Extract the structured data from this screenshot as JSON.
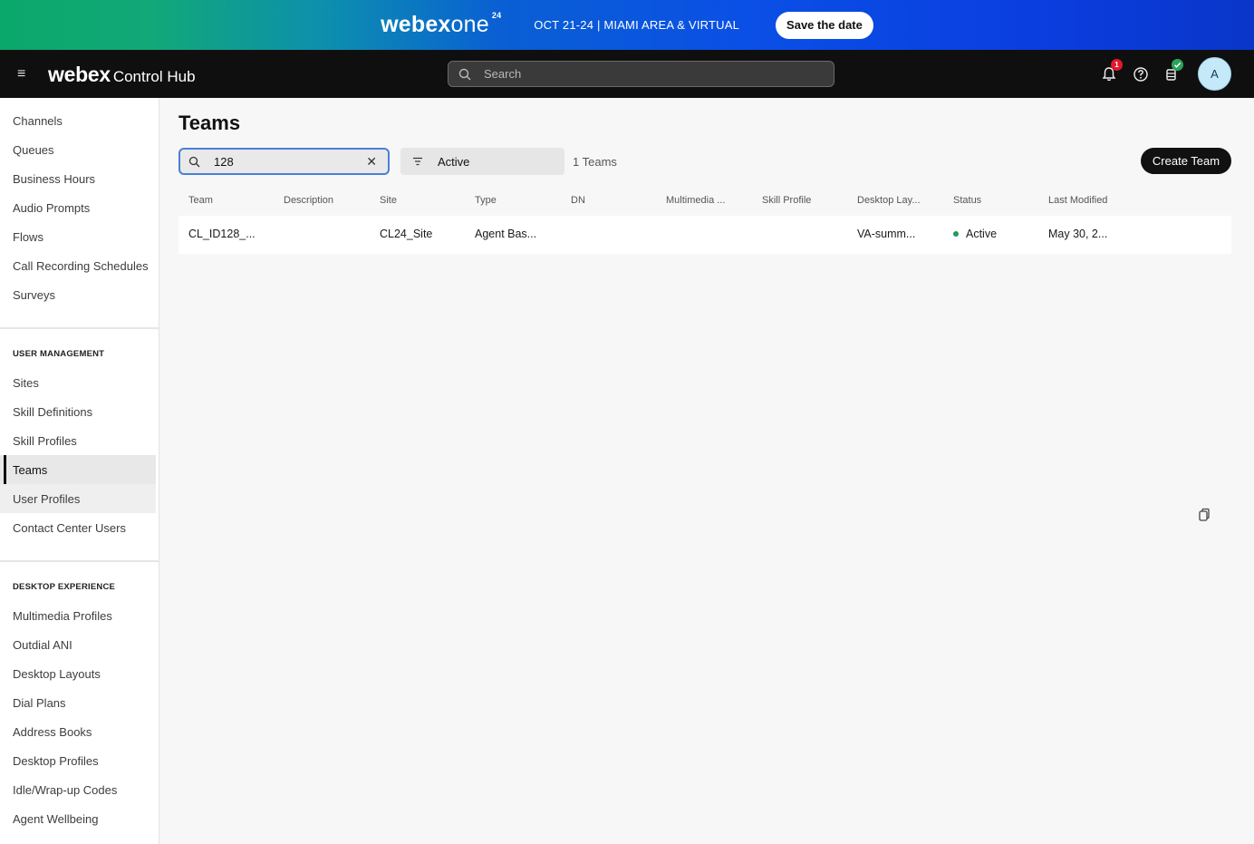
{
  "banner": {
    "logo_brand": "webex",
    "logo_one": "one",
    "logo_sup": "24",
    "event_text": "OCT 21-24 | MIAMI AREA & VIRTUAL",
    "cta_label": "Save the date"
  },
  "topbar": {
    "brand_webex": "webex",
    "brand_product": "Control Hub",
    "search_placeholder": "Search",
    "notification_count": "1",
    "avatar_initial": "A",
    "icons": [
      "menu-icon",
      "search-icon",
      "bell-icon",
      "help-icon",
      "apps-icon",
      "check-badge-icon"
    ]
  },
  "sidebar": {
    "group1": [
      "Channels",
      "Queues",
      "Business Hours",
      "Audio Prompts",
      "Flows",
      "Call Recording Schedules",
      "Surveys"
    ],
    "user_management_heading": "USER MANAGEMENT",
    "group2": [
      "Sites",
      "Skill Definitions",
      "Skill Profiles",
      "Teams",
      "User Profiles",
      "Contact Center Users"
    ],
    "desktop_experience_heading": "DESKTOP EXPERIENCE",
    "group3": [
      "Multimedia Profiles",
      "Outdial ANI",
      "Desktop Layouts",
      "Dial Plans",
      "Address Books",
      "Desktop Profiles",
      "Idle/Wrap-up Codes",
      "Agent Wellbeing"
    ],
    "selected": "Teams"
  },
  "main": {
    "title": "Teams",
    "search_value": "128",
    "status_filter": "Active",
    "count_text": "1 Teams",
    "create_label": "Create Team",
    "columns": [
      "Team",
      "Description",
      "Site",
      "Type",
      "DN",
      "Multimedia ...",
      "Skill Profile",
      "Desktop Lay...",
      "Status",
      "Last Modified"
    ],
    "rows": [
      {
        "team": "CL_ID128_...",
        "description": "",
        "site": "CL24_Site",
        "type": "Agent Bas...",
        "dn": "",
        "multimedia": "",
        "skill_profile": "",
        "desktop_layout": "VA-summ...",
        "status": "Active",
        "last_modified": "May 30, 2..."
      }
    ],
    "status_color": "#1f9a5c"
  }
}
